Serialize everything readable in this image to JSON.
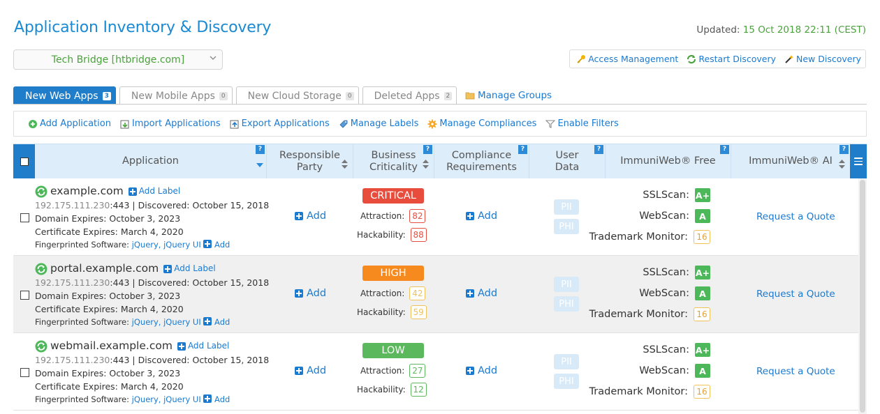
{
  "header": {
    "title": "Application Inventory & Discovery",
    "updated_label": "Updated:",
    "updated_value": "15 Oct 2018 22:11 (CEST)"
  },
  "company_select": {
    "value": "Tech Bridge [htbridge.com]"
  },
  "top_actions": [
    {
      "label": "Access Management",
      "icon": "key-icon"
    },
    {
      "label": "Restart Discovery",
      "icon": "refresh-icon"
    },
    {
      "label": "New Discovery",
      "icon": "wand-icon"
    }
  ],
  "tabs": [
    {
      "label": "New Web Apps",
      "count": "3",
      "active": true
    },
    {
      "label": "New Mobile Apps",
      "count": "0"
    },
    {
      "label": "New Cloud Storage",
      "count": "0"
    },
    {
      "label": "Deleted Apps",
      "count": "2"
    }
  ],
  "manage_groups": "Manage Groups",
  "toolbar": [
    {
      "label": "Add Application",
      "icon": "add-circle-icon"
    },
    {
      "label": "Import Applications",
      "icon": "import-icon"
    },
    {
      "label": "Export Applications",
      "icon": "export-icon"
    },
    {
      "label": "Manage Labels",
      "icon": "label-icon"
    },
    {
      "label": "Manage Compliances",
      "icon": "gear-icon"
    },
    {
      "label": "Enable Filters",
      "icon": "filter-icon"
    }
  ],
  "columns": {
    "application": "Application",
    "responsible": [
      "Responsible",
      "Party"
    ],
    "criticality": [
      "Business",
      "Criticality"
    ],
    "compliance": [
      "Compliance",
      "Requirements"
    ],
    "userdata": [
      "User",
      "Data"
    ],
    "free": "ImmuniWeb® Free",
    "ai": "ImmuniWeb® AI",
    "help": "?"
  },
  "common": {
    "add": "Add",
    "add_label": "Add Label",
    "ip_sep": " | Discovered: October 15, 2018",
    "domain_expires": "Domain Expires: October 3, 2023",
    "cert_expires": "Certificate Expires: March 4, 2020",
    "fp_label": "Fingerprinted Software:",
    "fp_software": "jQuery, jQuery UI",
    "attraction": "Attraction:",
    "hackability": "Hackability:",
    "pii": "PII",
    "phi": "PHI",
    "sslscan": "SSLScan:",
    "webscan": "WebScan:",
    "trademark": "Trademark Monitor:",
    "request_quote": "Request a Quote"
  },
  "rows": [
    {
      "name": "example.com",
      "ip": "192.175.111.230",
      "port": ":443",
      "criticality": "CRITICAL",
      "crit_color": "#e84c3d",
      "attraction": "82",
      "hackability": "88",
      "score_color": "#e84c3d",
      "ssl": "A+",
      "web": "A",
      "tm": "16"
    },
    {
      "name": "portal.example.com",
      "ip": "192.175.111.230",
      "port": ":443",
      "criticality": "HIGH",
      "crit_color": "#f68a1f",
      "attraction": "42",
      "hackability": "59",
      "score_color": "#f2c25a",
      "ssl": "A+",
      "web": "A",
      "tm": "16"
    },
    {
      "name": "webmail.example.com",
      "ip": "192.175.111.230",
      "port": ":443",
      "criticality": "LOW",
      "crit_color": "#5cb85c",
      "attraction": "27",
      "hackability": "12",
      "score_color": "#5cb85c",
      "ssl": "A+",
      "web": "A",
      "tm": "16"
    }
  ]
}
